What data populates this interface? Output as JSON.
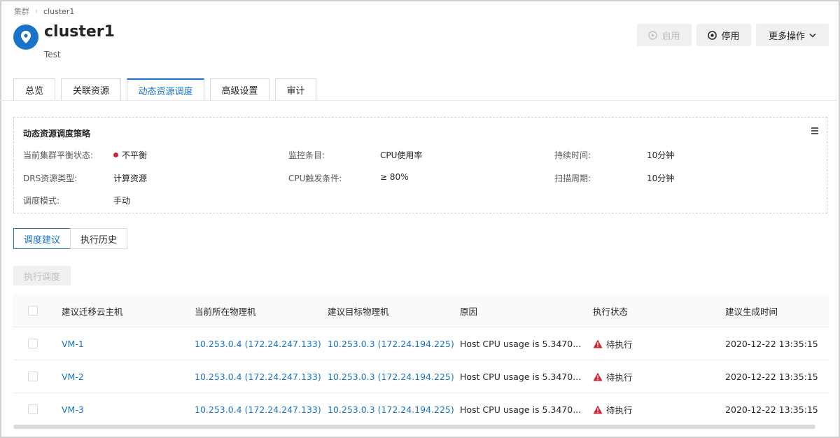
{
  "breadcrumb": {
    "root": "集群",
    "current": "cluster1"
  },
  "header": {
    "title": "cluster1",
    "subtitle": "Test",
    "icon": "location-pin-icon"
  },
  "actions": {
    "enable": "启用",
    "disable": "停用",
    "more": "更多操作"
  },
  "tabs": [
    "总览",
    "关联资源",
    "动态资源调度",
    "高级设置",
    "审计"
  ],
  "active_tab": "动态资源调度",
  "strategy": {
    "title": "动态资源调度策略",
    "balance_label": "当前集群平衡状态:",
    "balance_value": "不平衡",
    "balance_color": "#d0263a",
    "drs_type_label": "DRS资源类型:",
    "drs_type_value": "计算资源",
    "mode_label": "调度模式:",
    "mode_value": "手动",
    "monitor_label": "监控条目:",
    "monitor_value": "CPU使用率",
    "trigger_label": "CPU触发条件:",
    "trigger_value": "≥ 80%",
    "duration_label": "持续时间:",
    "duration_value": "10分钟",
    "scan_label": "扫描周期:",
    "scan_value": "10分钟"
  },
  "subtabs": [
    "调度建议",
    "执行历史"
  ],
  "execute_button": "执行调度",
  "table": {
    "columns": [
      "建议迁移云主机",
      "当前所在物理机",
      "建议目标物理机",
      "原因",
      "执行状态",
      "建议生成时间"
    ],
    "rows": [
      {
        "vm": "VM-1",
        "current": "10.253.0.4 (172.24.247.133)",
        "target": "10.253.0.3 (172.24.194.225)",
        "reason": "Host CPU usage is 5.3470...",
        "status": "待执行",
        "time": "2020-12-22 13:35:15"
      },
      {
        "vm": "VM-2",
        "current": "10.253.0.4 (172.24.247.133)",
        "target": "10.253.0.3 (172.24.194.225)",
        "reason": "Host CPU usage is 5.3470...",
        "status": "待执行",
        "time": "2020-12-22 13:35:15"
      },
      {
        "vm": "VM-3",
        "current": "10.253.0.4 (172.24.247.133)",
        "target": "10.253.0.3 (172.24.194.225)",
        "reason": "Host CPU usage is 5.3470...",
        "status": "待执行",
        "time": "2020-12-22 13:35:15"
      }
    ]
  },
  "colors": {
    "primary": "#1a73c8",
    "warning": "#d0263a"
  }
}
